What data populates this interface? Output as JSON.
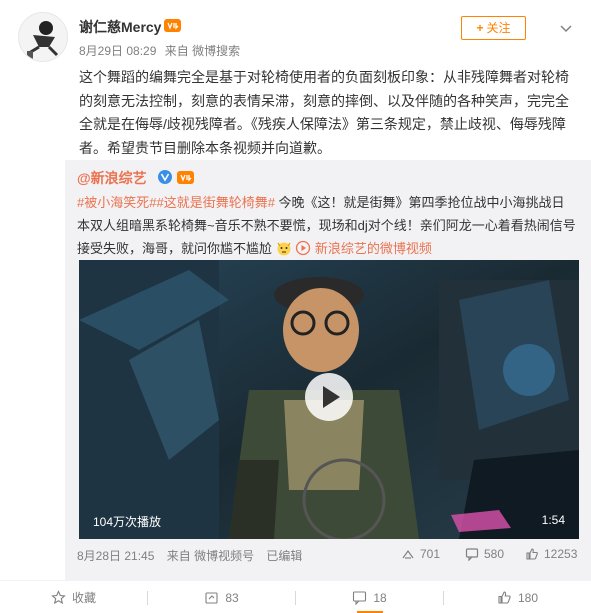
{
  "post": {
    "user_name": "谢仁慈Mercy",
    "date": "8月29日 08:29",
    "source": "来自 微博搜索",
    "follow_label": "关注",
    "text": "这个舞蹈的编舞完全是基于对轮椅使用者的负面刻板印象：从非残障舞者对轮椅的刻意无法控制，刻意的表情呆滞，刻意的摔倒、以及伴随的各种笑声，完完全全就是在侮辱/歧视残障者。《残疾人保障法》第三条规定，禁止歧视、侮辱残障者。希望贵节目删除本条视频并向道歉。"
  },
  "repost": {
    "author": "@新浪综艺",
    "hashtags": "#被小海笑死##这就是街舞轮椅舞#",
    "text": " 今晚《这！就是街舞》第四季抢位战中小海挑战日本双人组暗黑系轮椅舞~音乐不熟不要慌，现场和dj对个线！亲们阿龙一心着看热闹信号接受失败，海哥，就问你尴不尴尬",
    "video_link": "新浪综艺的微博视频",
    "video": {
      "view_count": "104万次播放",
      "duration": "1:54"
    },
    "date": "8月28日 21:45",
    "source": "来自 微博视频号",
    "edited": "已编辑",
    "share_count": "701",
    "comment_count": "580",
    "like_count": "12253"
  },
  "actions": {
    "collect": "收藏",
    "repost": "83",
    "comment": "18",
    "like": "180"
  },
  "colors": {
    "accent": "#ff8200",
    "link": "#eb7350",
    "muted": "#808080",
    "repost_bg": "#f2f2f5"
  },
  "icons": [
    "chevron-down-icon",
    "vip-icon",
    "verified-icon",
    "play-icon",
    "share-icon",
    "comment-icon",
    "like-icon",
    "collect-icon",
    "link-video-icon",
    "emoji-icon"
  ]
}
